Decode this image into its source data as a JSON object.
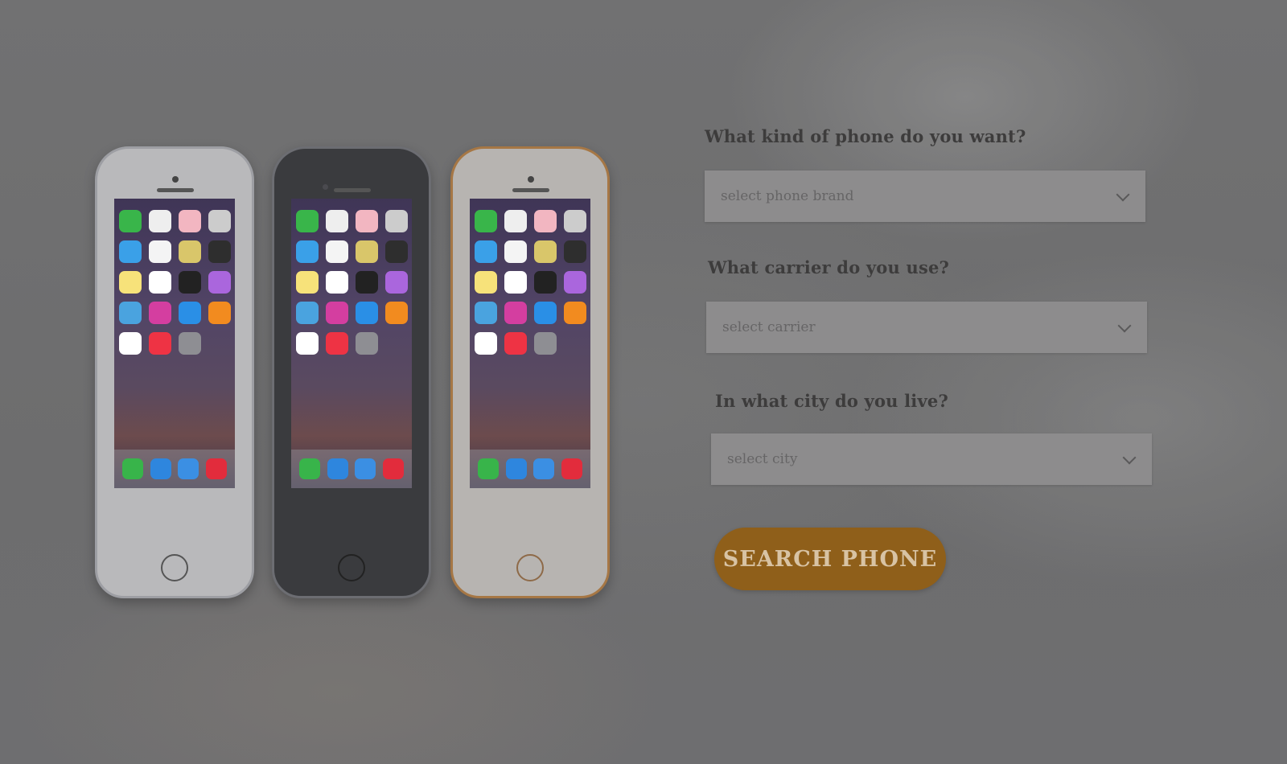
{
  "form": {
    "phone_question": "What kind of phone do you want?",
    "phone_placeholder": "select phone brand",
    "carrier_question": "What carrier do you use?",
    "carrier_placeholder": "select carrier",
    "city_question": "In what city do you live?",
    "city_placeholder": "select city",
    "search_button": "SEARCH PHONE"
  },
  "colors": {
    "accent": "#8f5f1a",
    "background": "#7a7a7b"
  }
}
